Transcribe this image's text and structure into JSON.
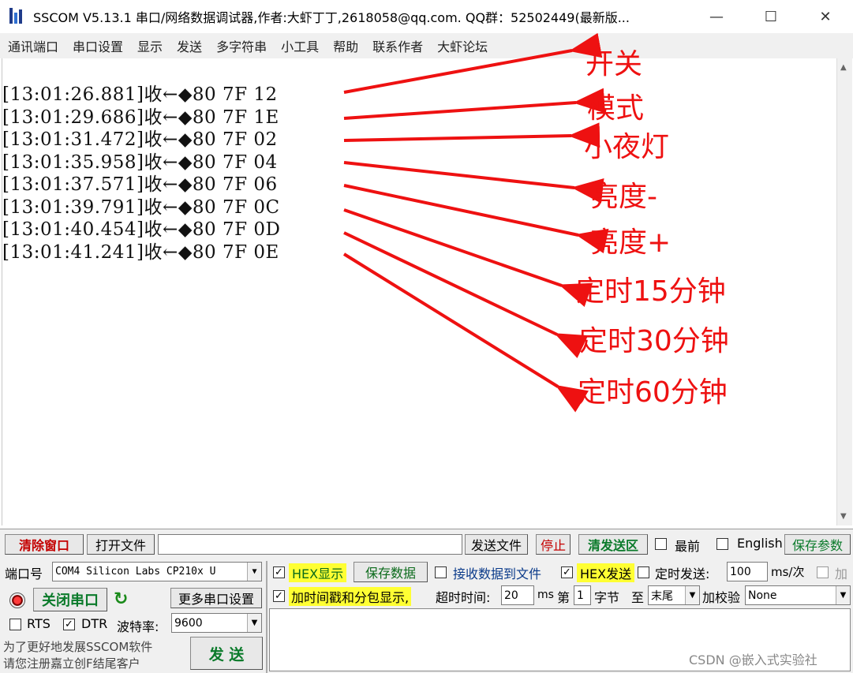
{
  "window": {
    "title": "SSCOM V5.13.1 串口/网络数据调试器,作者:大虾丁丁,2618058@qq.com. QQ群：52502449(最新版...",
    "minimize": "—",
    "maximize": "☐",
    "close": "✕"
  },
  "menu": [
    "通讯端口",
    "串口设置",
    "显示",
    "发送",
    "多字符串",
    "小工具",
    "帮助",
    "联系作者",
    "大虾论坛"
  ],
  "log": [
    "[13:01:26.881]收←◆80 7F 12",
    "[13:01:29.686]收←◆80 7F 1E",
    "[13:01:31.472]收←◆80 7F 02",
    "[13:01:35.958]收←◆80 7F 04",
    "[13:01:37.571]收←◆80 7F 06",
    "[13:01:39.791]收←◆80 7F 0C",
    "[13:01:40.454]收←◆80 7F 0D",
    "[13:01:41.241]收←◆80 7F 0E"
  ],
  "annotations": [
    "开关",
    "模式",
    "小夜灯",
    "亮度-",
    "亮度+",
    "定时15分钟",
    "定时30分钟",
    "定时60分钟"
  ],
  "annotation_color": "#ee1111",
  "toolbar": {
    "clear_window": "清除窗口",
    "open_file": "打开文件",
    "file_path": "",
    "send_file": "发送文件",
    "stop": "停止",
    "clear_send": "清发送区",
    "topmost": "最前",
    "english": "English",
    "save_params": "保存参数"
  },
  "port": {
    "port_label": "端口号",
    "port_value": "COM4 Silicon Labs CP210x U",
    "close_port": "关闭串口",
    "more_settings": "更多串口设置",
    "rts": "RTS",
    "dtr": "DTR",
    "baud_label": "波特率:",
    "baud_value": "9600",
    "promo_line1": "为了更好地发展SSCOM软件",
    "promo_line2": "请您注册嘉立创F结尾客户",
    "send": "发 送"
  },
  "options": {
    "hex_display": "HEX显示",
    "save_data": "保存数据",
    "recv_to_file": "接收数据到文件",
    "hex_send": "HEX发送",
    "timed_send": "定时发送:",
    "interval": "100",
    "interval_unit": "ms/次",
    "add_enter": "加",
    "timestamp": "加时间戳和分包显示,",
    "timeout_label": "超时时间:",
    "timeout": "20",
    "timeout_unit": "ms",
    "nth_label": "第",
    "nth_value": "1",
    "byte_label": "字节",
    "to_label": "至",
    "end_value": "末尾",
    "checksum_label": "加校验",
    "checksum_value": "None"
  },
  "watermark": "CSDN @嵌入式实验社"
}
